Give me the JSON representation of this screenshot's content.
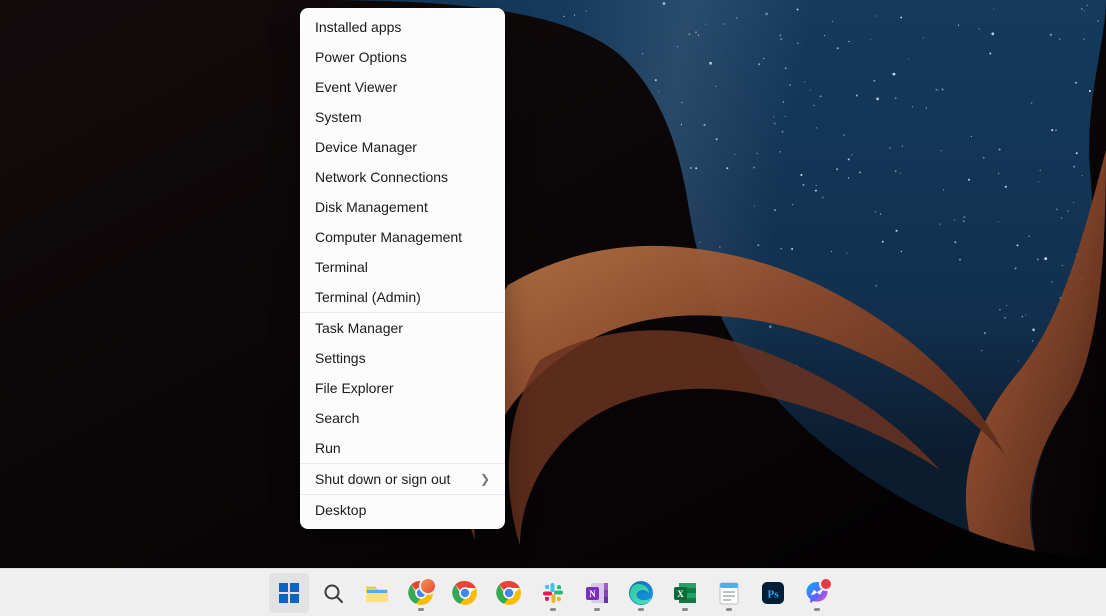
{
  "winx_menu": {
    "groups": [
      {
        "items": [
          {
            "label": "Installed apps",
            "submenu": false
          },
          {
            "label": "Power Options",
            "submenu": false
          },
          {
            "label": "Event Viewer",
            "submenu": false
          },
          {
            "label": "System",
            "submenu": false
          },
          {
            "label": "Device Manager",
            "submenu": false
          },
          {
            "label": "Network Connections",
            "submenu": false
          },
          {
            "label": "Disk Management",
            "submenu": false
          },
          {
            "label": "Computer Management",
            "submenu": false
          },
          {
            "label": "Terminal",
            "submenu": false
          },
          {
            "label": "Terminal (Admin)",
            "submenu": false
          }
        ]
      },
      {
        "items": [
          {
            "label": "Task Manager",
            "submenu": false
          },
          {
            "label": "Settings",
            "submenu": false
          },
          {
            "label": "File Explorer",
            "submenu": false
          },
          {
            "label": "Search",
            "submenu": false
          },
          {
            "label": "Run",
            "submenu": false
          }
        ]
      },
      {
        "items": [
          {
            "label": "Shut down or sign out",
            "submenu": true
          }
        ]
      },
      {
        "items": [
          {
            "label": "Desktop",
            "submenu": false
          }
        ]
      }
    ]
  },
  "taskbar": {
    "items": [
      {
        "name": "start",
        "icon": "windows-icon",
        "running": false,
        "active": true,
        "badge": null
      },
      {
        "name": "search",
        "icon": "search-icon",
        "running": false,
        "active": false,
        "badge": null
      },
      {
        "name": "file-explorer",
        "icon": "file-explorer-icon",
        "running": false,
        "active": false,
        "badge": null
      },
      {
        "name": "chrome-profile1",
        "icon": "chrome-icon",
        "running": true,
        "active": false,
        "badge": "user"
      },
      {
        "name": "chrome-profile2",
        "icon": "chrome-icon",
        "running": false,
        "active": false,
        "badge": null
      },
      {
        "name": "chrome-profile3",
        "icon": "chrome-icon",
        "running": false,
        "active": false,
        "badge": null
      },
      {
        "name": "slack",
        "icon": "slack-icon",
        "running": true,
        "active": false,
        "badge": null
      },
      {
        "name": "onenote",
        "icon": "onenote-icon",
        "running": true,
        "active": false,
        "badge": null
      },
      {
        "name": "edge",
        "icon": "edge-icon",
        "running": true,
        "active": false,
        "badge": null
      },
      {
        "name": "excel",
        "icon": "excel-icon",
        "running": true,
        "active": false,
        "badge": null
      },
      {
        "name": "notepad",
        "icon": "notepad-icon",
        "running": true,
        "active": false,
        "badge": null
      },
      {
        "name": "photoshop",
        "icon": "photoshop-icon",
        "running": false,
        "active": false,
        "badge": null
      },
      {
        "name": "messenger",
        "icon": "messenger-icon",
        "running": true,
        "active": false,
        "badge": "alert"
      }
    ]
  }
}
